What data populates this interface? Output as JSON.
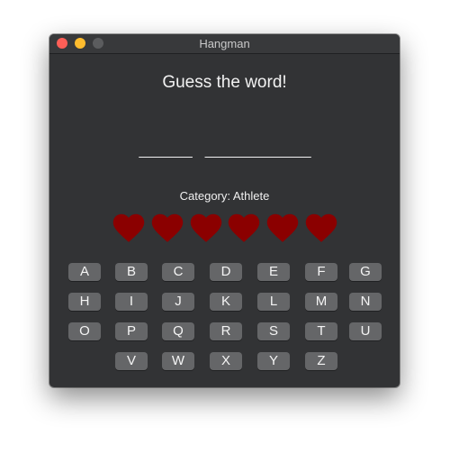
{
  "window": {
    "title": "Hangman"
  },
  "game": {
    "heading": "Guess the word!",
    "word_display": "____ ________",
    "category": "Category: Athlete",
    "lives": 6,
    "heart_color": "#8b0000"
  },
  "keyboard": {
    "rows": [
      [
        "A",
        "B",
        "C",
        "D",
        "E",
        "F",
        "G"
      ],
      [
        "H",
        "I",
        "J",
        "K",
        "L",
        "M",
        "N"
      ],
      [
        "O",
        "P",
        "Q",
        "R",
        "S",
        "T",
        "U"
      ],
      [
        "V",
        "W",
        "X",
        "Y",
        "Z"
      ]
    ]
  },
  "colors": {
    "window_background": "#323335",
    "key_background": "#656668",
    "close": "#fe5f57",
    "minimize": "#febc2e"
  }
}
